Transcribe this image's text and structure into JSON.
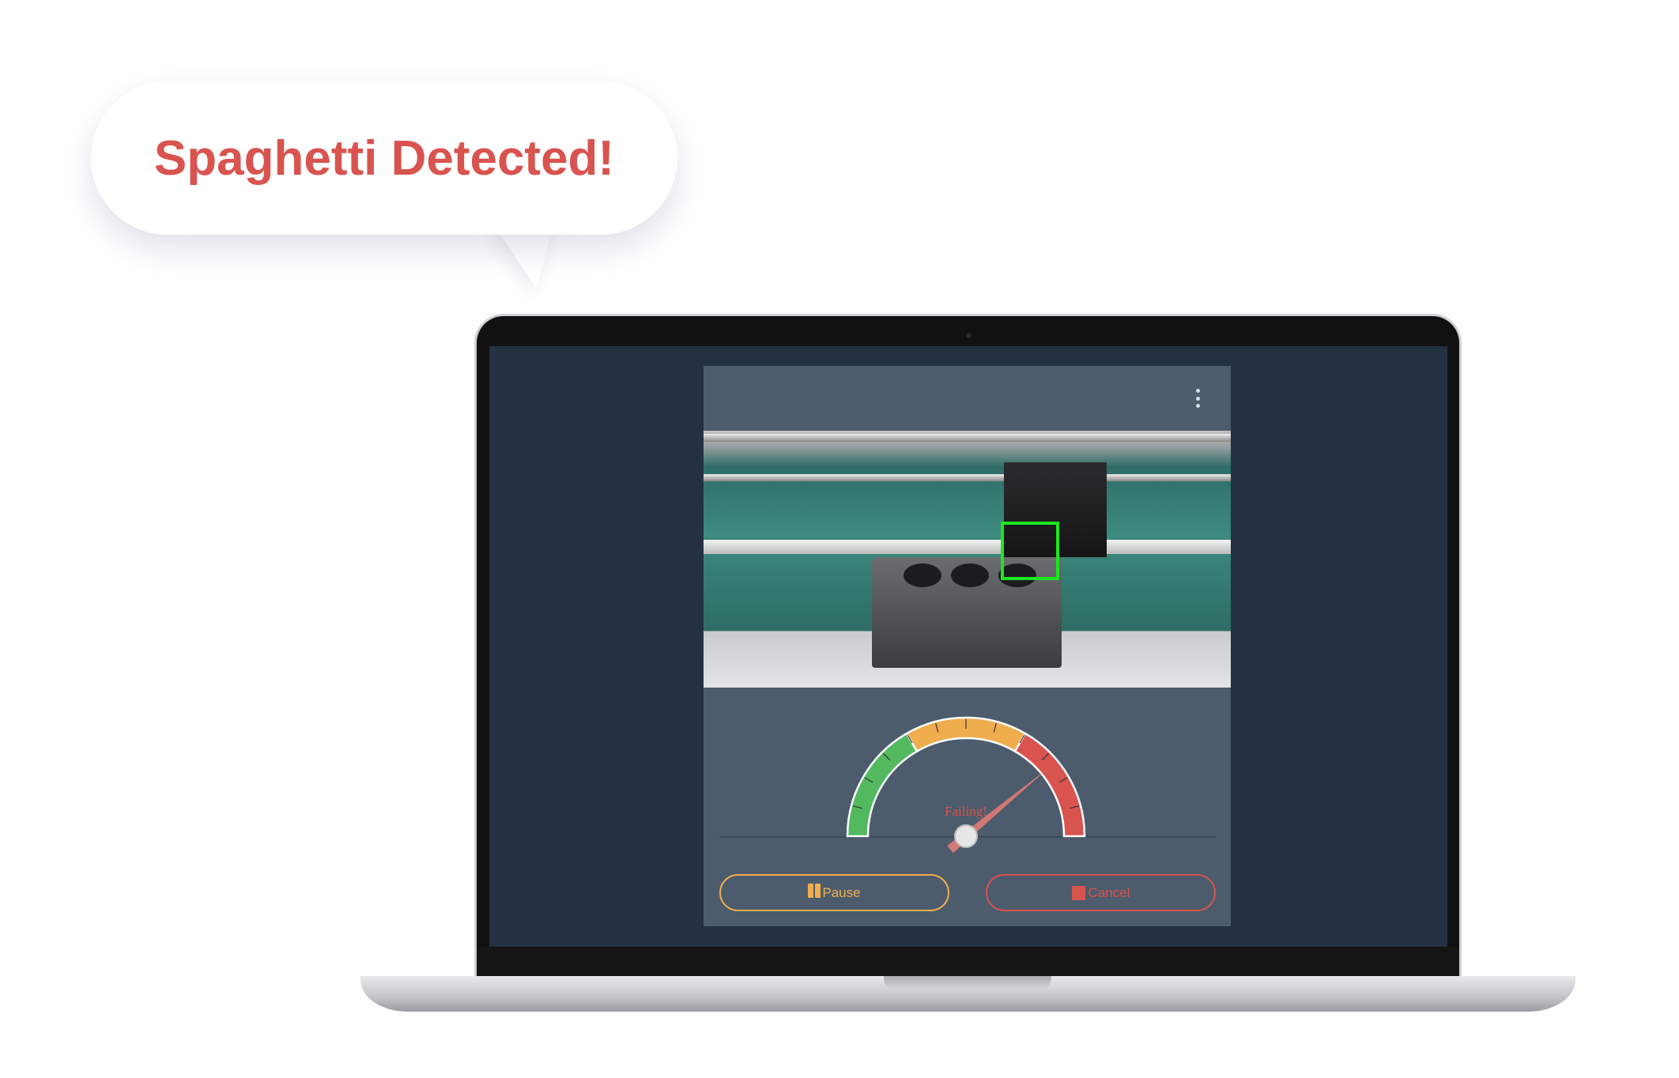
{
  "callout": {
    "text": "Spaghetti Detected!"
  },
  "panel": {
    "menu_icon": "kebab-menu-icon",
    "gauge": {
      "label": "Failing!",
      "value": 0.78,
      "zones": [
        {
          "name": "good",
          "color": "#52b95f"
        },
        {
          "name": "warning",
          "color": "#f0ad4e"
        },
        {
          "name": "failing",
          "color": "#d9534f"
        }
      ]
    },
    "buttons": {
      "pause_label": "Pause",
      "cancel_label": "Cancel"
    }
  },
  "colors": {
    "accent_red": "#d9534f",
    "accent_orange": "#f0ad4e",
    "accent_green": "#52b95f",
    "detection_box": "#1ee61e"
  }
}
